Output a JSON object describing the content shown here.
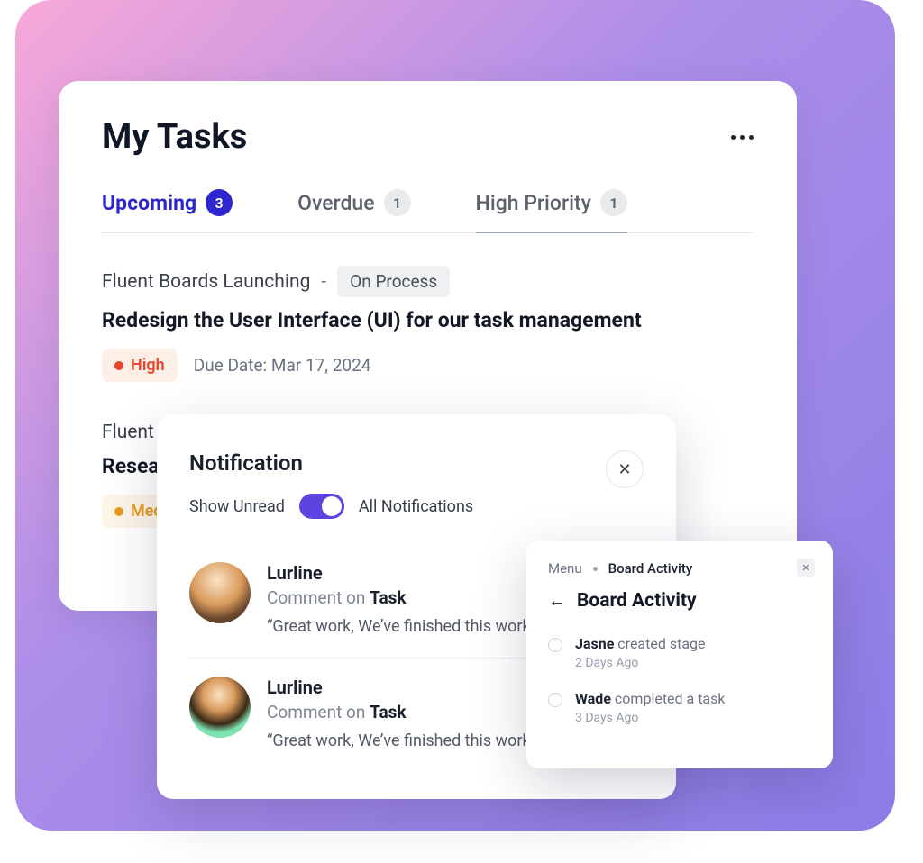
{
  "tasks": {
    "title": "My Tasks",
    "tabs": [
      {
        "label": "Upcoming",
        "count": "3",
        "active": true
      },
      {
        "label": "Overdue",
        "count": "1",
        "active": false
      },
      {
        "label": "High Priority",
        "count": "1",
        "active": false
      }
    ],
    "items": [
      {
        "project": "Fluent Boards Launching",
        "status": "On Process",
        "title": "Redesign the User Interface (UI) for our task management",
        "priority": "High",
        "due_label": "Due Date:",
        "due_value": "Mar 17, 2024"
      },
      {
        "project": "Fluent",
        "title": "Resea",
        "priority": "Medi"
      }
    ]
  },
  "notification": {
    "title": "Notification",
    "show_unread": "Show Unread",
    "all_label": "All Notifications",
    "items": [
      {
        "name": "Lurline",
        "action_prefix": "Comment on ",
        "action_bold": "Task",
        "quote": "“Great work, We’ve finished this work"
      },
      {
        "name": "Lurline",
        "action_prefix": "Comment on ",
        "action_bold": "Task",
        "quote": "“Great work, We’ve finished this work"
      }
    ]
  },
  "activity": {
    "breadcrumb_menu": "Menu",
    "breadcrumb_current": "Board Activity",
    "title": "Board Activity",
    "items": [
      {
        "name": "Jasne",
        "action": " created stage",
        "time": "2 Days Ago"
      },
      {
        "name": "Wade",
        "action": " completed a task",
        "time": "3 Days Ago"
      }
    ]
  }
}
